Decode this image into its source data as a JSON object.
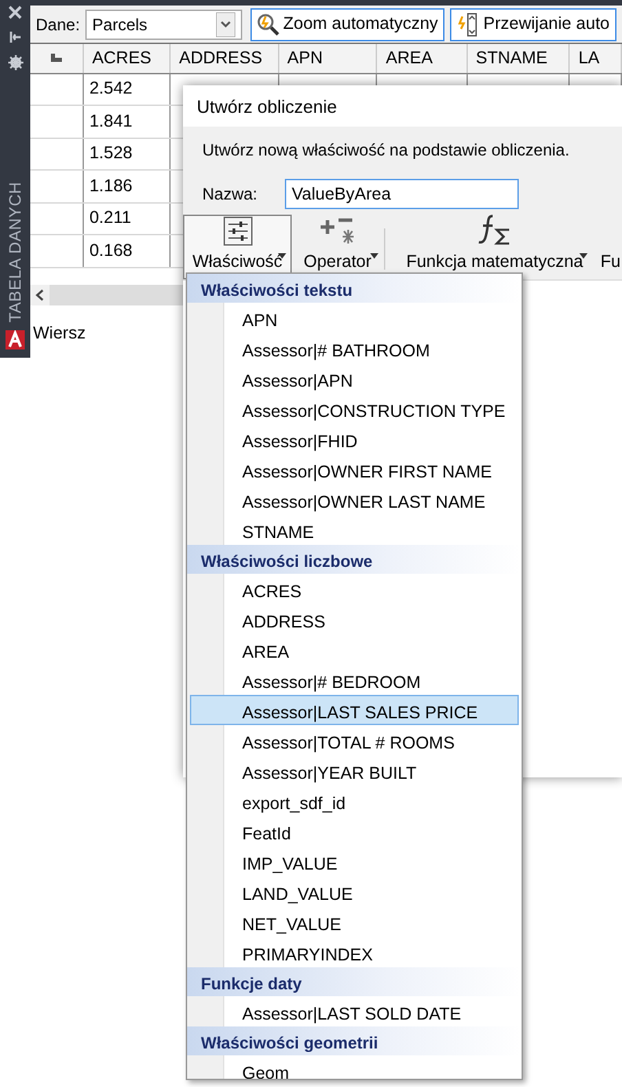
{
  "side_panel": {
    "title": "TABELA DANYCH"
  },
  "toolbar": {
    "data_label": "Dane:",
    "data_source": "Parcels",
    "buttons": [
      "Zoom automatyczny",
      "Przewijanie auto"
    ]
  },
  "table": {
    "columns": [
      "ACRES",
      "ADDRESS",
      "APN",
      "AREA",
      "STNAME",
      "LA"
    ],
    "rows": [
      {
        "acres": "2.542"
      },
      {
        "acres": "1.841"
      },
      {
        "acres": "1.528"
      },
      {
        "acres": "1.186"
      },
      {
        "acres": "0.211"
      },
      {
        "acres": "0.168"
      }
    ],
    "footer": "Wiersz"
  },
  "dialog": {
    "title": "Utwórz obliczenie",
    "description": "Utwórz nową właściwość na podstawie obliczenia.",
    "name_label": "Nazwa:",
    "name_value": "ValueByArea",
    "tools": [
      {
        "kind": "property",
        "label": "Właściwość",
        "selected": true,
        "dropdown": true
      },
      {
        "kind": "operator",
        "label": "Operator",
        "selected": false,
        "dropdown": true
      },
      {
        "kind": "function",
        "label": "Funkcja matematyczna",
        "selected": false,
        "dropdown": true
      },
      {
        "kind": "cut",
        "label": "Fu",
        "selected": false,
        "dropdown": false
      }
    ]
  },
  "menu": {
    "groups": [
      {
        "title": "Właściwości tekstu",
        "items": [
          {
            "label": "APN",
            "selected": false
          },
          {
            "label": "Assessor|# BATHROOM",
            "selected": false
          },
          {
            "label": "Assessor|APN",
            "selected": false
          },
          {
            "label": "Assessor|CONSTRUCTION TYPE",
            "selected": false
          },
          {
            "label": "Assessor|FHID",
            "selected": false
          },
          {
            "label": "Assessor|OWNER FIRST NAME",
            "selected": false
          },
          {
            "label": "Assessor|OWNER LAST NAME",
            "selected": false
          },
          {
            "label": "STNAME",
            "selected": false
          }
        ]
      },
      {
        "title": "Właściwości liczbowe",
        "items": [
          {
            "label": "ACRES",
            "selected": false
          },
          {
            "label": "ADDRESS",
            "selected": false
          },
          {
            "label": "AREA",
            "selected": false
          },
          {
            "label": "Assessor|# BEDROOM",
            "selected": false
          },
          {
            "label": "Assessor|LAST SALES PRICE",
            "selected": true
          },
          {
            "label": "Assessor|TOTAL # ROOMS",
            "selected": false
          },
          {
            "label": "Assessor|YEAR BUILT",
            "selected": false
          },
          {
            "label": "export_sdf_id",
            "selected": false
          },
          {
            "label": "FeatId",
            "selected": false
          },
          {
            "label": "IMP_VALUE",
            "selected": false
          },
          {
            "label": "LAND_VALUE",
            "selected": false
          },
          {
            "label": "NET_VALUE",
            "selected": false
          },
          {
            "label": "PRIMARYINDEX",
            "selected": false
          }
        ]
      },
      {
        "title": "Funkcje daty",
        "items": [
          {
            "label": "Assessor|LAST SOLD DATE",
            "selected": false
          }
        ]
      },
      {
        "title": "Właściwości geometrii",
        "items": [
          {
            "label": "Geom",
            "selected": false
          }
        ]
      }
    ]
  }
}
